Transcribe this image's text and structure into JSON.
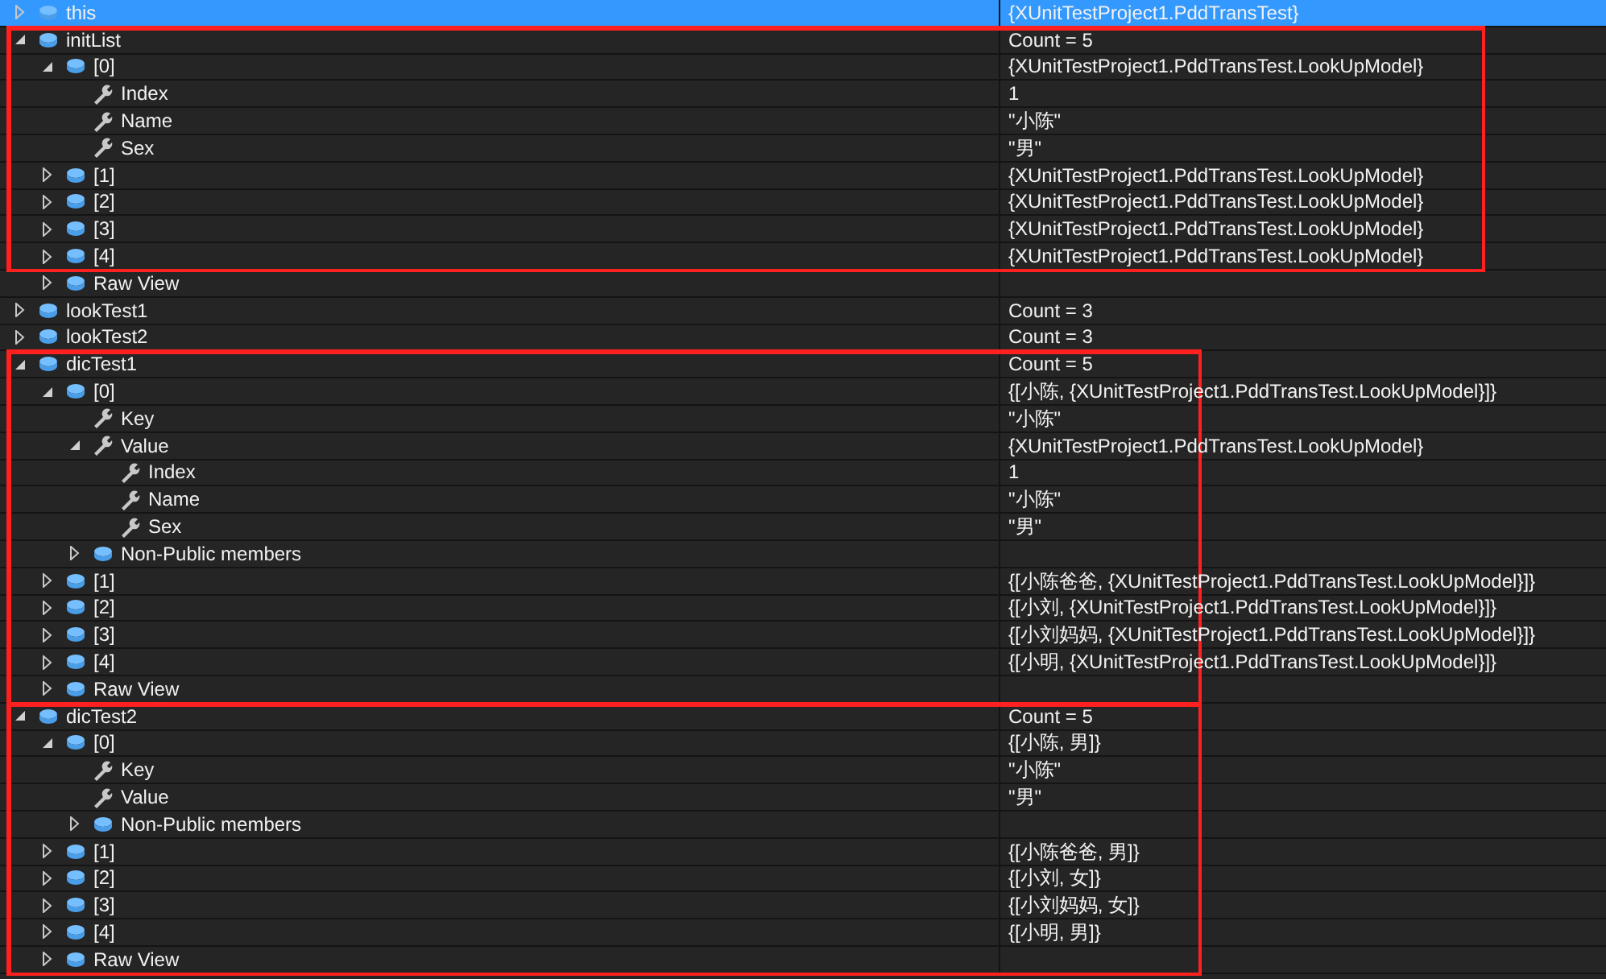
{
  "locals": [
    {
      "name": "this",
      "value": "{XUnitTestProject1.PddTransTest}",
      "kind": "object",
      "expanded": false,
      "selected": true
    },
    {
      "name": "initList",
      "value": "Count = 5",
      "kind": "object",
      "expanded": true,
      "highlight": {
        "kind": "wide"
      },
      "children": [
        {
          "name": "[0]",
          "value": "{XUnitTestProject1.PddTransTest.LookUpModel}",
          "kind": "object",
          "expanded": true,
          "children": [
            {
              "name": "Index",
              "value": "1",
              "kind": "property"
            },
            {
              "name": "Name",
              "value": "\"小陈\"",
              "kind": "property"
            },
            {
              "name": "Sex",
              "value": "\"男\"",
              "kind": "property"
            }
          ]
        },
        {
          "name": "[1]",
          "value": "{XUnitTestProject1.PddTransTest.LookUpModel}",
          "kind": "object",
          "expanded": false
        },
        {
          "name": "[2]",
          "value": "{XUnitTestProject1.PddTransTest.LookUpModel}",
          "kind": "object",
          "expanded": false
        },
        {
          "name": "[3]",
          "value": "{XUnitTestProject1.PddTransTest.LookUpModel}",
          "kind": "object",
          "expanded": false
        },
        {
          "name": "[4]",
          "value": "{XUnitTestProject1.PddTransTest.LookUpModel}",
          "kind": "object",
          "expanded": false
        },
        {
          "name": "Raw View",
          "kind": "object",
          "expanded": false,
          "outside_frame": true
        }
      ]
    },
    {
      "name": "lookTest1",
      "value": "Count = 3",
      "kind": "object",
      "expanded": false
    },
    {
      "name": "lookTest2",
      "value": "Count = 3",
      "kind": "object",
      "expanded": false
    },
    {
      "name": "dicTest1",
      "value": "Count = 5",
      "kind": "object",
      "expanded": true,
      "highlight": {
        "kind": "narrow"
      },
      "children": [
        {
          "name": "[0]",
          "value": "{[小陈, {XUnitTestProject1.PddTransTest.LookUpModel}]}",
          "kind": "object",
          "expanded": true,
          "children": [
            {
              "name": "Key",
              "value": "\"小陈\"",
              "kind": "property"
            },
            {
              "name": "Value",
              "value": "{XUnitTestProject1.PddTransTest.LookUpModel}",
              "kind": "property",
              "expanded": true,
              "children": [
                {
                  "name": "Index",
                  "value": "1",
                  "kind": "property"
                },
                {
                  "name": "Name",
                  "value": "\"小陈\"",
                  "kind": "property"
                },
                {
                  "name": "Sex",
                  "value": "\"男\"",
                  "kind": "property"
                }
              ]
            },
            {
              "name": "Non-Public members",
              "kind": "object",
              "expanded": false
            }
          ]
        },
        {
          "name": "[1]",
          "value": "{[小陈爸爸, {XUnitTestProject1.PddTransTest.LookUpModel}]}",
          "kind": "object",
          "expanded": false
        },
        {
          "name": "[2]",
          "value": "{[小刘, {XUnitTestProject1.PddTransTest.LookUpModel}]}",
          "kind": "object",
          "expanded": false
        },
        {
          "name": "[3]",
          "value": "{[小刘妈妈, {XUnitTestProject1.PddTransTest.LookUpModel}]}",
          "kind": "object",
          "expanded": false
        },
        {
          "name": "[4]",
          "value": "{[小明, {XUnitTestProject1.PddTransTest.LookUpModel}]}",
          "kind": "object",
          "expanded": false
        },
        {
          "name": "Raw View",
          "kind": "object",
          "expanded": false
        }
      ]
    },
    {
      "name": "dicTest2",
      "value": "Count = 5",
      "kind": "object",
      "expanded": true,
      "highlight": {
        "kind": "narrow"
      },
      "children": [
        {
          "name": "[0]",
          "value": "{[小陈, 男]}",
          "kind": "object",
          "expanded": true,
          "children": [
            {
              "name": "Key",
              "value": "\"小陈\"",
              "kind": "property"
            },
            {
              "name": "Value",
              "value": "\"男\"",
              "kind": "property"
            },
            {
              "name": "Non-Public members",
              "kind": "object",
              "expanded": false
            }
          ]
        },
        {
          "name": "[1]",
          "value": "{[小陈爸爸, 男]}",
          "kind": "object",
          "expanded": false
        },
        {
          "name": "[2]",
          "value": "{[小刘, 女]}",
          "kind": "object",
          "expanded": false
        },
        {
          "name": "[3]",
          "value": "{[小刘妈妈, 女]}",
          "kind": "object",
          "expanded": false
        },
        {
          "name": "[4]",
          "value": "{[小明, 男]}",
          "kind": "object",
          "expanded": false
        },
        {
          "name": "Raw View",
          "kind": "object",
          "expanded": false
        }
      ]
    }
  ]
}
